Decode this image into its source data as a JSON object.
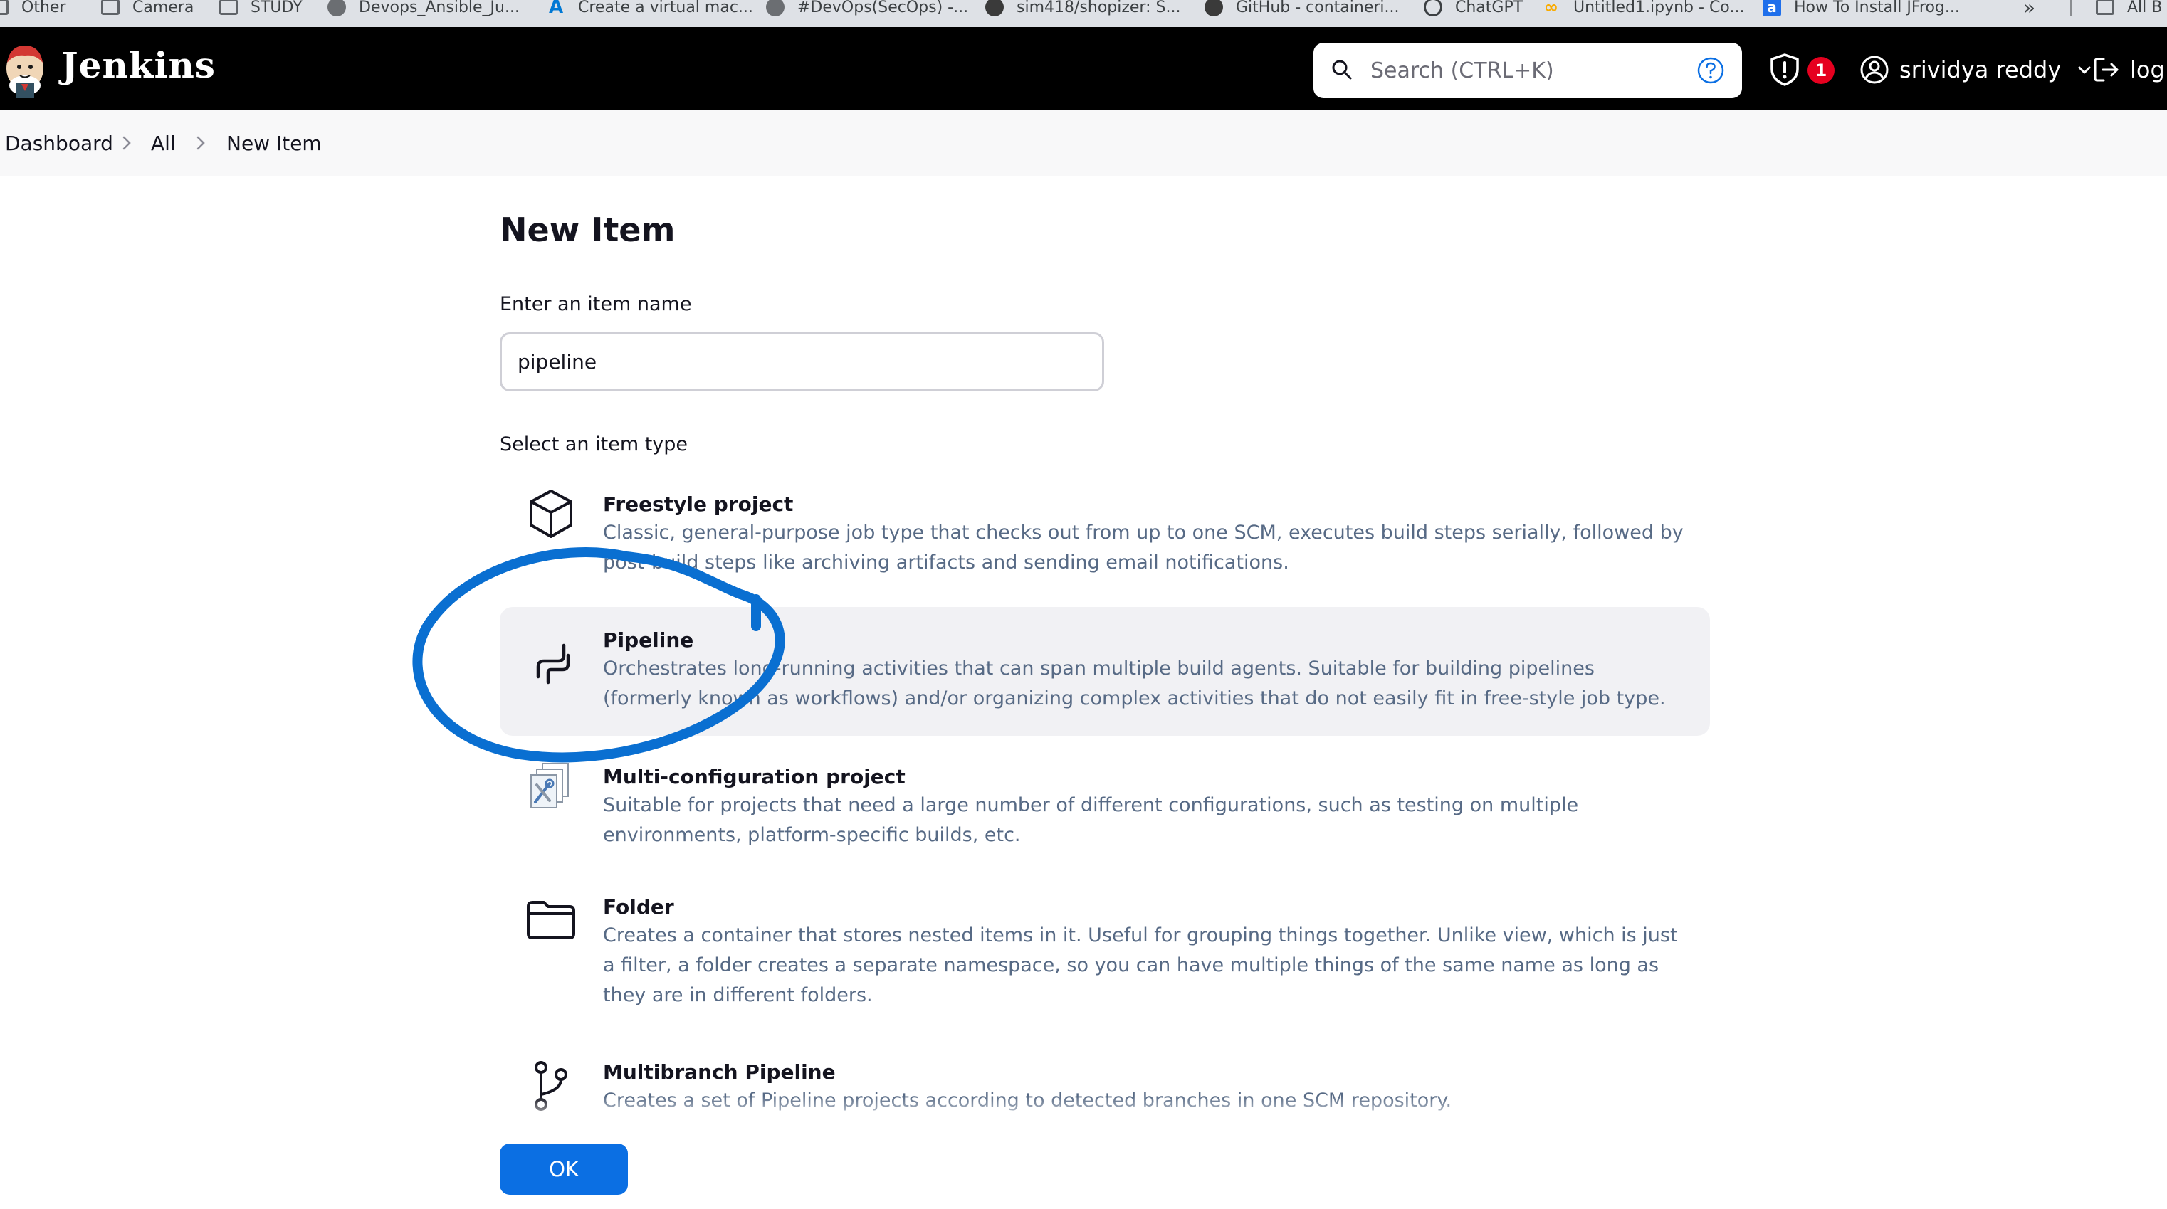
{
  "bookmarks": [
    {
      "label": "Other",
      "icon": "folder-icon"
    },
    {
      "label": "Camera",
      "icon": "folder-icon"
    },
    {
      "label": "STUDY",
      "icon": "folder-icon"
    },
    {
      "label": "Devops_Ansible_Ju...",
      "icon": "globe-icon"
    },
    {
      "label": "Create a virtual mac...",
      "icon": "azure-icon"
    },
    {
      "label": "#DevOps(SecOps) -...",
      "icon": "globe-icon"
    },
    {
      "label": "sim418/shopizer: S...",
      "icon": "github-icon"
    },
    {
      "label": "GitHub - containeri...",
      "icon": "github-icon"
    },
    {
      "label": "ChatGPT",
      "icon": "chatgpt-icon"
    },
    {
      "label": "Untitled1.ipynb - Co...",
      "icon": "colab-icon"
    },
    {
      "label": "How To Install JFrog...",
      "icon": "jfrog-icon"
    },
    {
      "label": "All B",
      "icon": "folder-icon"
    }
  ],
  "header": {
    "brand": "Jenkins",
    "search_placeholder": "Search (CTRL+K)",
    "notification_count": "1",
    "user_name": "srividya reddy",
    "logout_label": "log"
  },
  "breadcrumb": [
    "Dashboard",
    "All",
    "New Item"
  ],
  "main": {
    "title": "New Item",
    "name_label": "Enter an item name",
    "name_value": "pipeline",
    "type_label": "Select an item type",
    "items": [
      {
        "title": "Freestyle project",
        "icon": "cube-icon",
        "desc": "Classic, general-purpose job type that checks out from up to one SCM, executes build steps serially, followed by post-build steps like archiving artifacts and sending email notifications."
      },
      {
        "title": "Pipeline",
        "icon": "pipeline-icon",
        "desc": "Orchestrates long-running activities that can span multiple build agents. Suitable for building pipelines (formerly known as workflows) and/or organizing complex activities that do not easily fit in free-style job type."
      },
      {
        "title": "Multi-configuration project",
        "icon": "multi-config-icon",
        "desc": "Suitable for projects that need a large number of different configurations, such as testing on multiple environments, platform-specific builds, etc."
      },
      {
        "title": "Folder",
        "icon": "folder-icon",
        "desc": "Creates a container that stores nested items in it. Useful for grouping things together. Unlike view, which is just a filter, a folder creates a separate namespace, so you can have multiple things of the same name as long as they are in different folders."
      },
      {
        "title": "Multibranch Pipeline",
        "icon": "branch-icon",
        "desc": "Creates a set of Pipeline projects according to detected branches in one SCM repository."
      }
    ],
    "ok_label": "OK"
  },
  "colors": {
    "header_bg": "#000000",
    "accent": "#0b6fe3",
    "annotation": "#0a6fd1",
    "badge": "#e6001f",
    "description_text": "#576a85"
  }
}
